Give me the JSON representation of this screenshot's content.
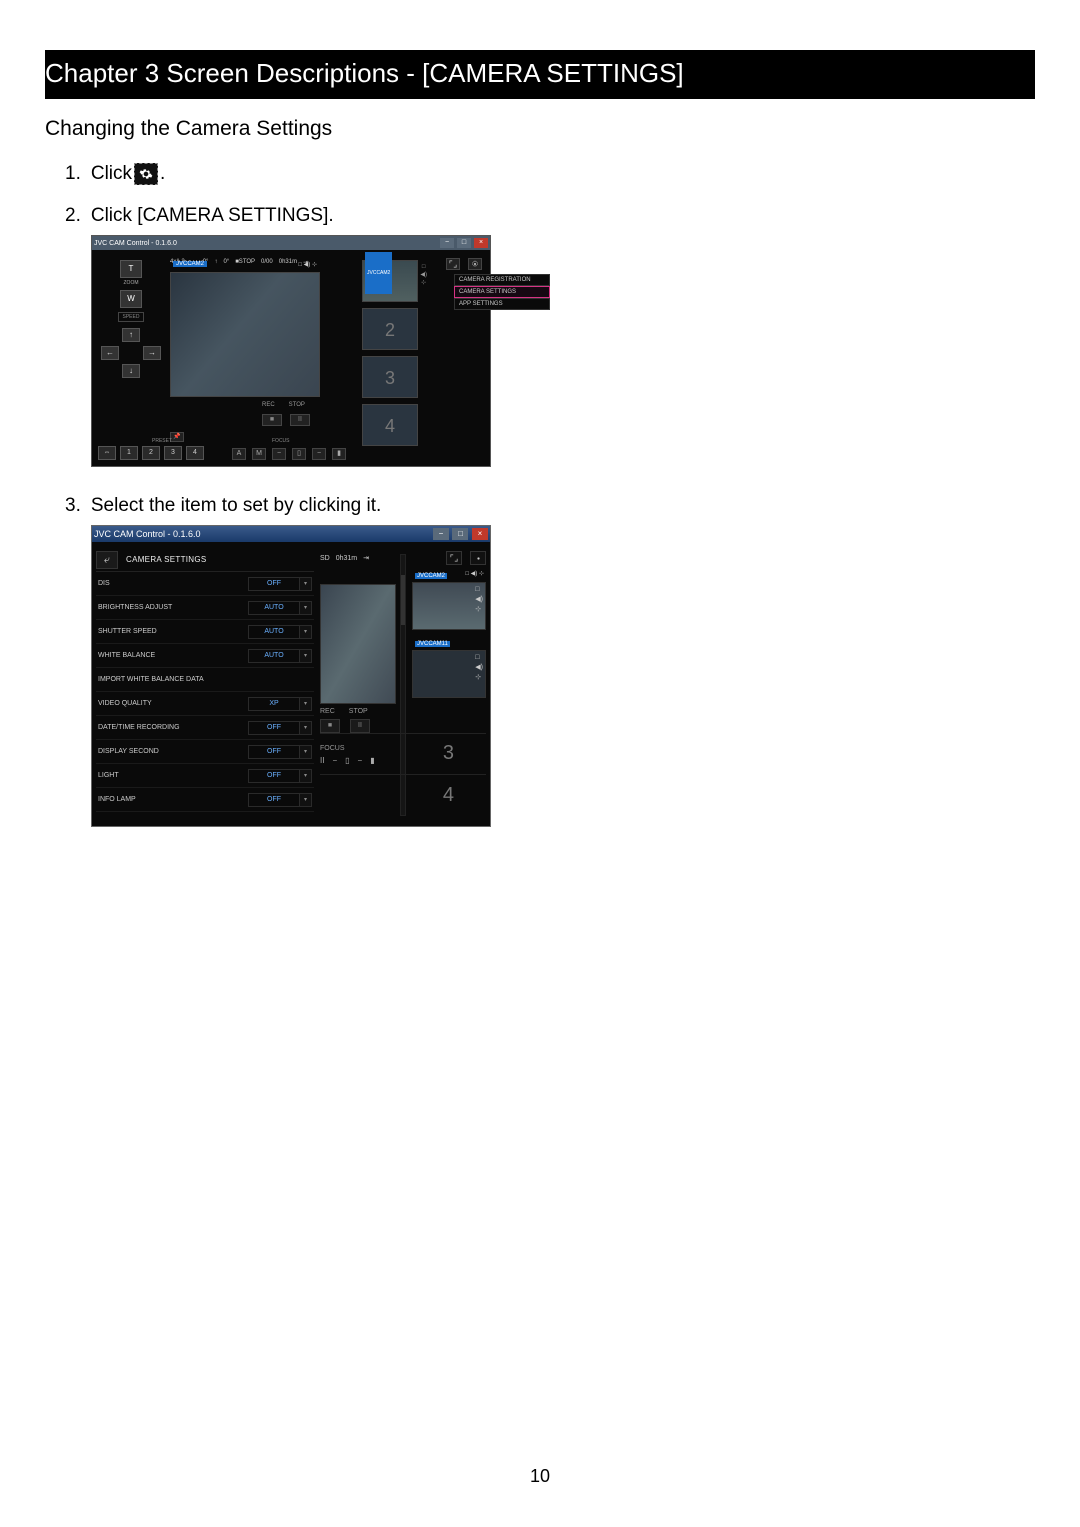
{
  "chapter_title": "Chapter 3   Screen Descriptions - [CAMERA SETTINGS]",
  "section_title": "Changing the Camera Settings",
  "steps": {
    "s1": {
      "num": "1.",
      "text_a": "Click ",
      "text_b": "."
    },
    "s2": {
      "num": "2.",
      "text": "Click [CAMERA SETTINGS]."
    },
    "s3": {
      "num": "3.",
      "text": "Select the item to set by clicking it."
    }
  },
  "page_number": "10",
  "shot1": {
    "titlebar": "JVC CAM Control - 0.1.6.0",
    "status": [
      "4x1.2",
      "→",
      "0°",
      "↑",
      "0°",
      "■STOP",
      "0/00",
      "0h31m",
      "⇥"
    ],
    "zoom": {
      "t": "T",
      "label": "ZOOM",
      "w": "W",
      "speed": "SPEED"
    },
    "dpad": {
      "up": "↑",
      "left": "←",
      "right": "→",
      "down": "↓"
    },
    "cam_badge": "JVCCAM2",
    "rec_label": "REC",
    "stop_label": "STOP",
    "rec_btn": "■",
    "pause_btn": "II",
    "pin": "📌",
    "preset_label": "PRESET",
    "focus_label": "FOCUS",
    "presets": [
      "⇔",
      "1",
      "2",
      "3",
      "4"
    ],
    "focus_btns": [
      "A",
      "M",
      "−",
      "▯",
      "−",
      "▮"
    ],
    "thumbs": [
      {
        "badge": "JVCCAM2",
        "num": ""
      },
      {
        "badge": "",
        "num": "2"
      },
      {
        "badge": "",
        "num": "3"
      },
      {
        "badge": "",
        "num": "4"
      }
    ],
    "menu": [
      {
        "label": "CAMERA REGISTRATION",
        "sel": false
      },
      {
        "label": "CAMERA SETTINGS",
        "sel": true
      },
      {
        "label": "APP SETTINGS",
        "sel": false
      }
    ]
  },
  "shot2": {
    "titlebar": "JVC CAM Control - 0.1.6.0",
    "panel_title": "CAMERA SETTINGS",
    "back": "⤶",
    "settings": [
      {
        "label": "DIS",
        "value": "OFF"
      },
      {
        "label": "BRIGHTNESS ADJUST",
        "value": "AUTO"
      },
      {
        "label": "SHUTTER SPEED",
        "value": "AUTO"
      },
      {
        "label": "WHITE BALANCE",
        "value": "AUTO"
      },
      {
        "label": "IMPORT WHITE BALANCE DATA",
        "value": null
      },
      {
        "label": "VIDEO QUALITY",
        "value": "XP"
      },
      {
        "label": "DATE/TIME RECORDING",
        "value": "OFF"
      },
      {
        "label": "DISPLAY SECOND",
        "value": "OFF"
      },
      {
        "label": "LIGHT",
        "value": "OFF"
      },
      {
        "label": "INFO LAMP",
        "value": "OFF"
      }
    ],
    "status": {
      "sd": "SD",
      "time": "0h31m",
      "arrow": "⇥"
    },
    "preview_icons": "□ ◀) ⊹",
    "thumbs": [
      {
        "badge": "JVCCAM2"
      },
      {
        "badge": "JVCCAM11"
      }
    ],
    "slot3": "3",
    "slot4": "4",
    "rec_label": "REC",
    "stop_label": "STOP",
    "rec_btn": "■",
    "pause_btn": "II",
    "focus_label": "FOCUS",
    "focus_btns": [
      "II",
      "−",
      "▯",
      "−",
      "▮"
    ]
  }
}
